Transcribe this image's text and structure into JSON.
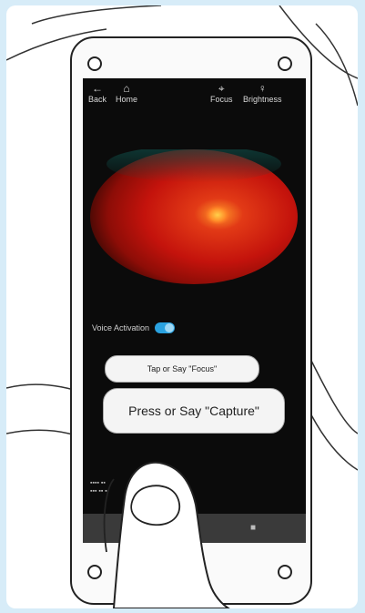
{
  "topbar": {
    "back_label": "Back",
    "home_label": "Home",
    "focus_label": "Focus",
    "brightness_label": "Brightness"
  },
  "icons": {
    "back": "arrow-left-icon",
    "home": "home-icon",
    "focus": "focus-icon",
    "brightness": "lightbulb-icon"
  },
  "voice_activation": {
    "label": "Voice Activation",
    "enabled": true
  },
  "buttons": {
    "focus": "Tap or Say \"Focus\"",
    "capture": "Press or Say \"Capture\""
  },
  "colors": {
    "toggle_on": "#2aa2e0",
    "background": "#d7ecf8"
  }
}
